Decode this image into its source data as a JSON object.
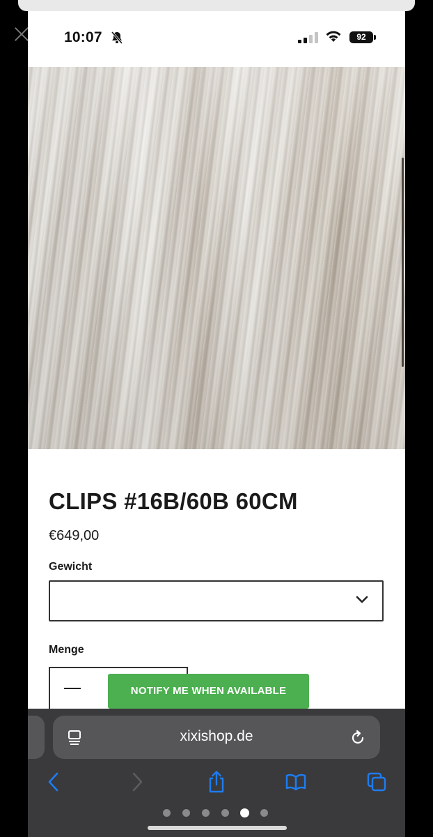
{
  "status_bar": {
    "time": "10:07",
    "battery": "92",
    "icons": [
      "bell-slash-icon",
      "signal-icon",
      "wifi-icon",
      "battery-icon"
    ]
  },
  "product": {
    "image_alt": "hair-extension-photo",
    "title": "CLIPS #16B/60B 60CM",
    "price": "€649,00",
    "weight_label": "Gewicht",
    "weight_value": "",
    "quantity_label": "Menge",
    "quantity_decrement_symbol": "—",
    "notify_label": "NOTIFY ME WHEN AVAILABLE",
    "notify_color": "#4caf50"
  },
  "browser": {
    "url": "xixishop.de",
    "toolbar_icons": [
      "back-icon",
      "forward-icon",
      "share-icon",
      "bookmarks-icon",
      "tabs-icon"
    ],
    "page_dots": {
      "count": 6,
      "active_index": 4
    },
    "accent": "#1e7cf0"
  },
  "chrome": {
    "close_icon": "close-icon"
  }
}
